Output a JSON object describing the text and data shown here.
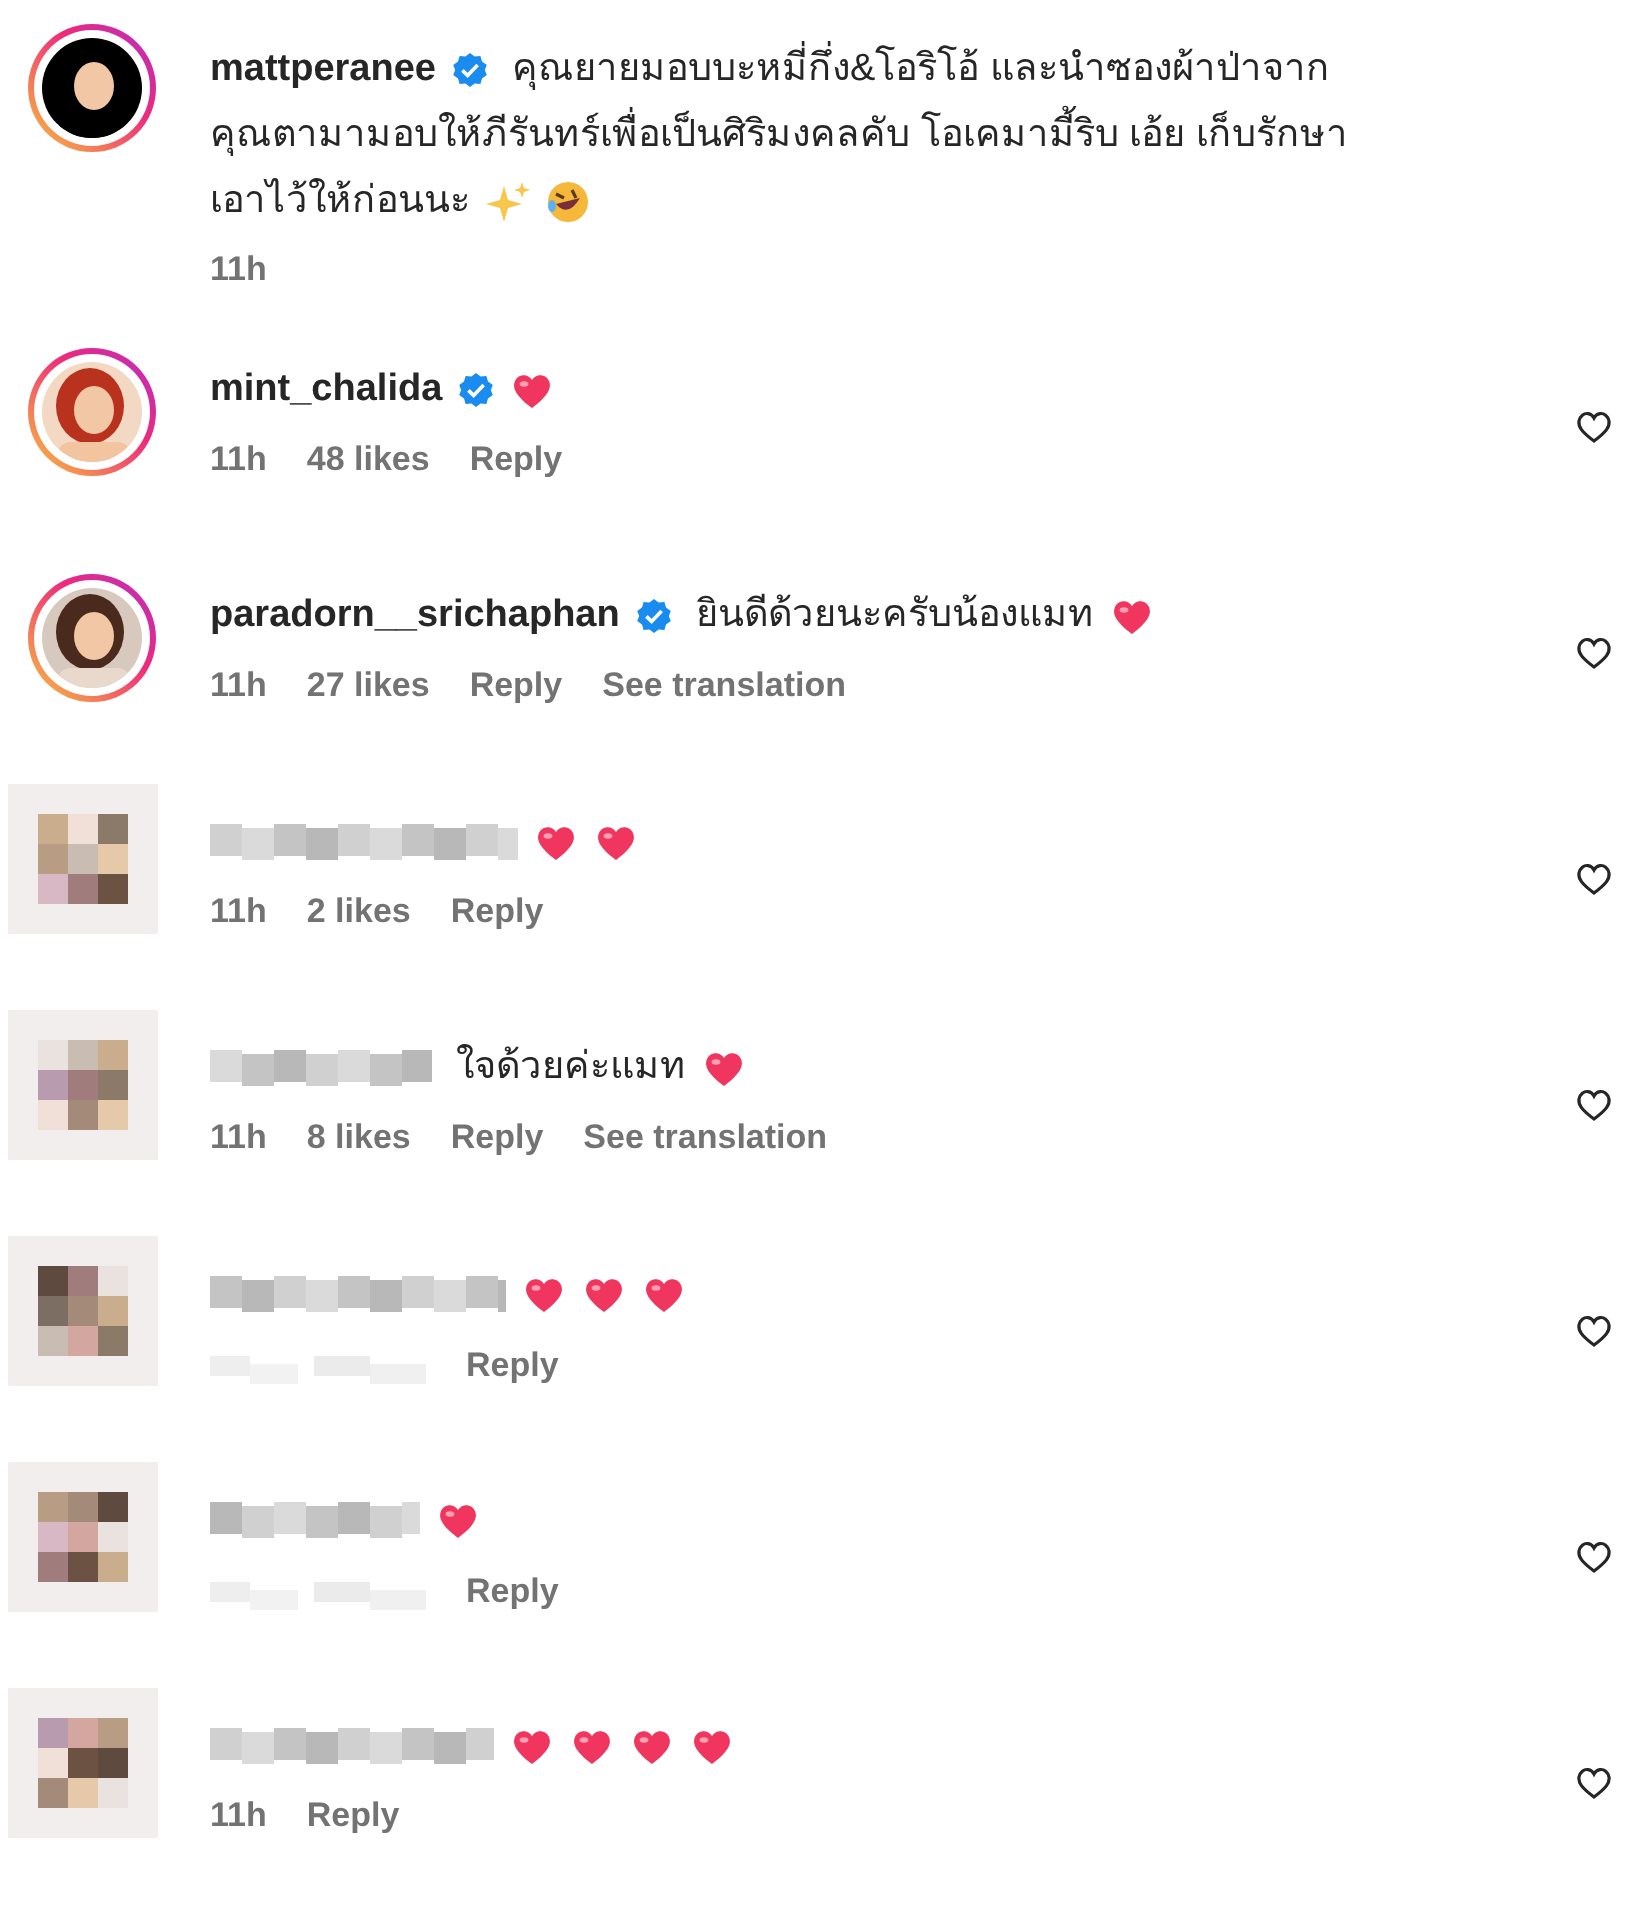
{
  "post_caption": {
    "kind": "profile",
    "username": "mattperanee",
    "verified": true,
    "story_ring": true,
    "text": "คุณยายมอบบะหมี่กึ่ง&โอริโอ้ และนำซองผ้าป่าจาก\nคุณตามามอบให้ภีรันทร์เพื่อเป็นศิริมงคลคับ โอเคมามี้ริบ เอ้ย เก็บรักษา\nเอาไว้ให้ก่อนนะ",
    "emojis": [
      {
        "kind": "sparkles"
      },
      {
        "kind": "laughing-face"
      }
    ],
    "meta": [
      {
        "kind": "text",
        "text": "11h"
      }
    ]
  },
  "comments": [
    {
      "kind": "profile",
      "story_ring": true,
      "username": "mint_chalida",
      "verified": true,
      "emojis": [
        {
          "kind": "heart"
        }
      ],
      "meta": [
        {
          "kind": "text",
          "text": "11h"
        },
        {
          "kind": "text",
          "text": "48 likes"
        },
        {
          "kind": "text",
          "text": "Reply"
        }
      ]
    },
    {
      "kind": "profile",
      "story_ring": true,
      "username": "paradorn__srichaphan",
      "verified": true,
      "text": "ยินดีด้วยนะครับน้องแมท",
      "emojis": [
        {
          "kind": "heart"
        }
      ],
      "meta": [
        {
          "kind": "text",
          "text": "11h"
        },
        {
          "kind": "text",
          "text": "27 likes"
        },
        {
          "kind": "text",
          "text": "Reply"
        },
        {
          "kind": "text",
          "text": "See translation"
        }
      ]
    },
    {
      "kind": "blurred",
      "emojis": [
        {
          "kind": "heart"
        },
        {
          "kind": "heart"
        }
      ],
      "meta": [
        {
          "kind": "text",
          "text": "11h"
        },
        {
          "kind": "text",
          "text": "2 likes"
        },
        {
          "kind": "text",
          "text": "Reply"
        }
      ]
    },
    {
      "kind": "blurred",
      "text": "ใจด้วยค่ะแมท",
      "emojis": [
        {
          "kind": "heart"
        }
      ],
      "meta": [
        {
          "kind": "text",
          "text": "11h"
        },
        {
          "kind": "text",
          "text": "8 likes"
        },
        {
          "kind": "text",
          "text": "Reply"
        },
        {
          "kind": "text",
          "text": "See translation"
        }
      ]
    },
    {
      "kind": "blurred",
      "emojis": [
        {
          "kind": "heart"
        },
        {
          "kind": "heart"
        },
        {
          "kind": "heart"
        }
      ],
      "meta": [
        {
          "kind": "blurred"
        },
        {
          "kind": "text",
          "text": "Reply"
        }
      ]
    },
    {
      "kind": "blurred",
      "emojis": [
        {
          "kind": "heart"
        }
      ],
      "meta": [
        {
          "kind": "blurred"
        },
        {
          "kind": "text",
          "text": "Reply"
        }
      ]
    },
    {
      "kind": "blurred",
      "emojis": [
        {
          "kind": "heart"
        },
        {
          "kind": "heart"
        },
        {
          "kind": "heart"
        },
        {
          "kind": "heart"
        }
      ],
      "meta": [
        {
          "kind": "text",
          "text": "11h"
        },
        {
          "kind": "text",
          "text": "Reply"
        }
      ]
    }
  ]
}
